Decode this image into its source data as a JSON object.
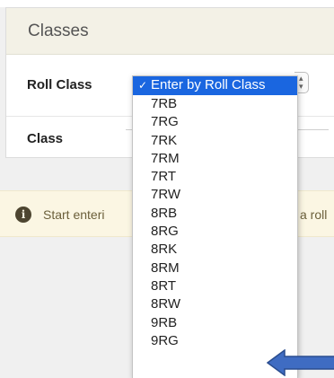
{
  "panel": {
    "title": "Classes",
    "roll_class_label": "Roll Class",
    "class_label": "Class"
  },
  "alert": {
    "icon": "info-icon",
    "text_left": "Start enteri",
    "text_right": "a roll"
  },
  "dropdown": {
    "check_glyph": "✓",
    "selected": "Enter by Roll Class",
    "options": [
      "7RB",
      "7RG",
      "7RK",
      "7RM",
      "7RT",
      "7RW",
      "8RB",
      "8RG",
      "8RK",
      "8RM",
      "8RT",
      "8RW",
      "9RB",
      "9RG"
    ]
  },
  "colors": {
    "selected_bg": "#1a66e0",
    "header_bg": "#f3f1e6",
    "alert_bg": "#fbf6e3",
    "annotation_arrow": "#3f6cc2"
  }
}
